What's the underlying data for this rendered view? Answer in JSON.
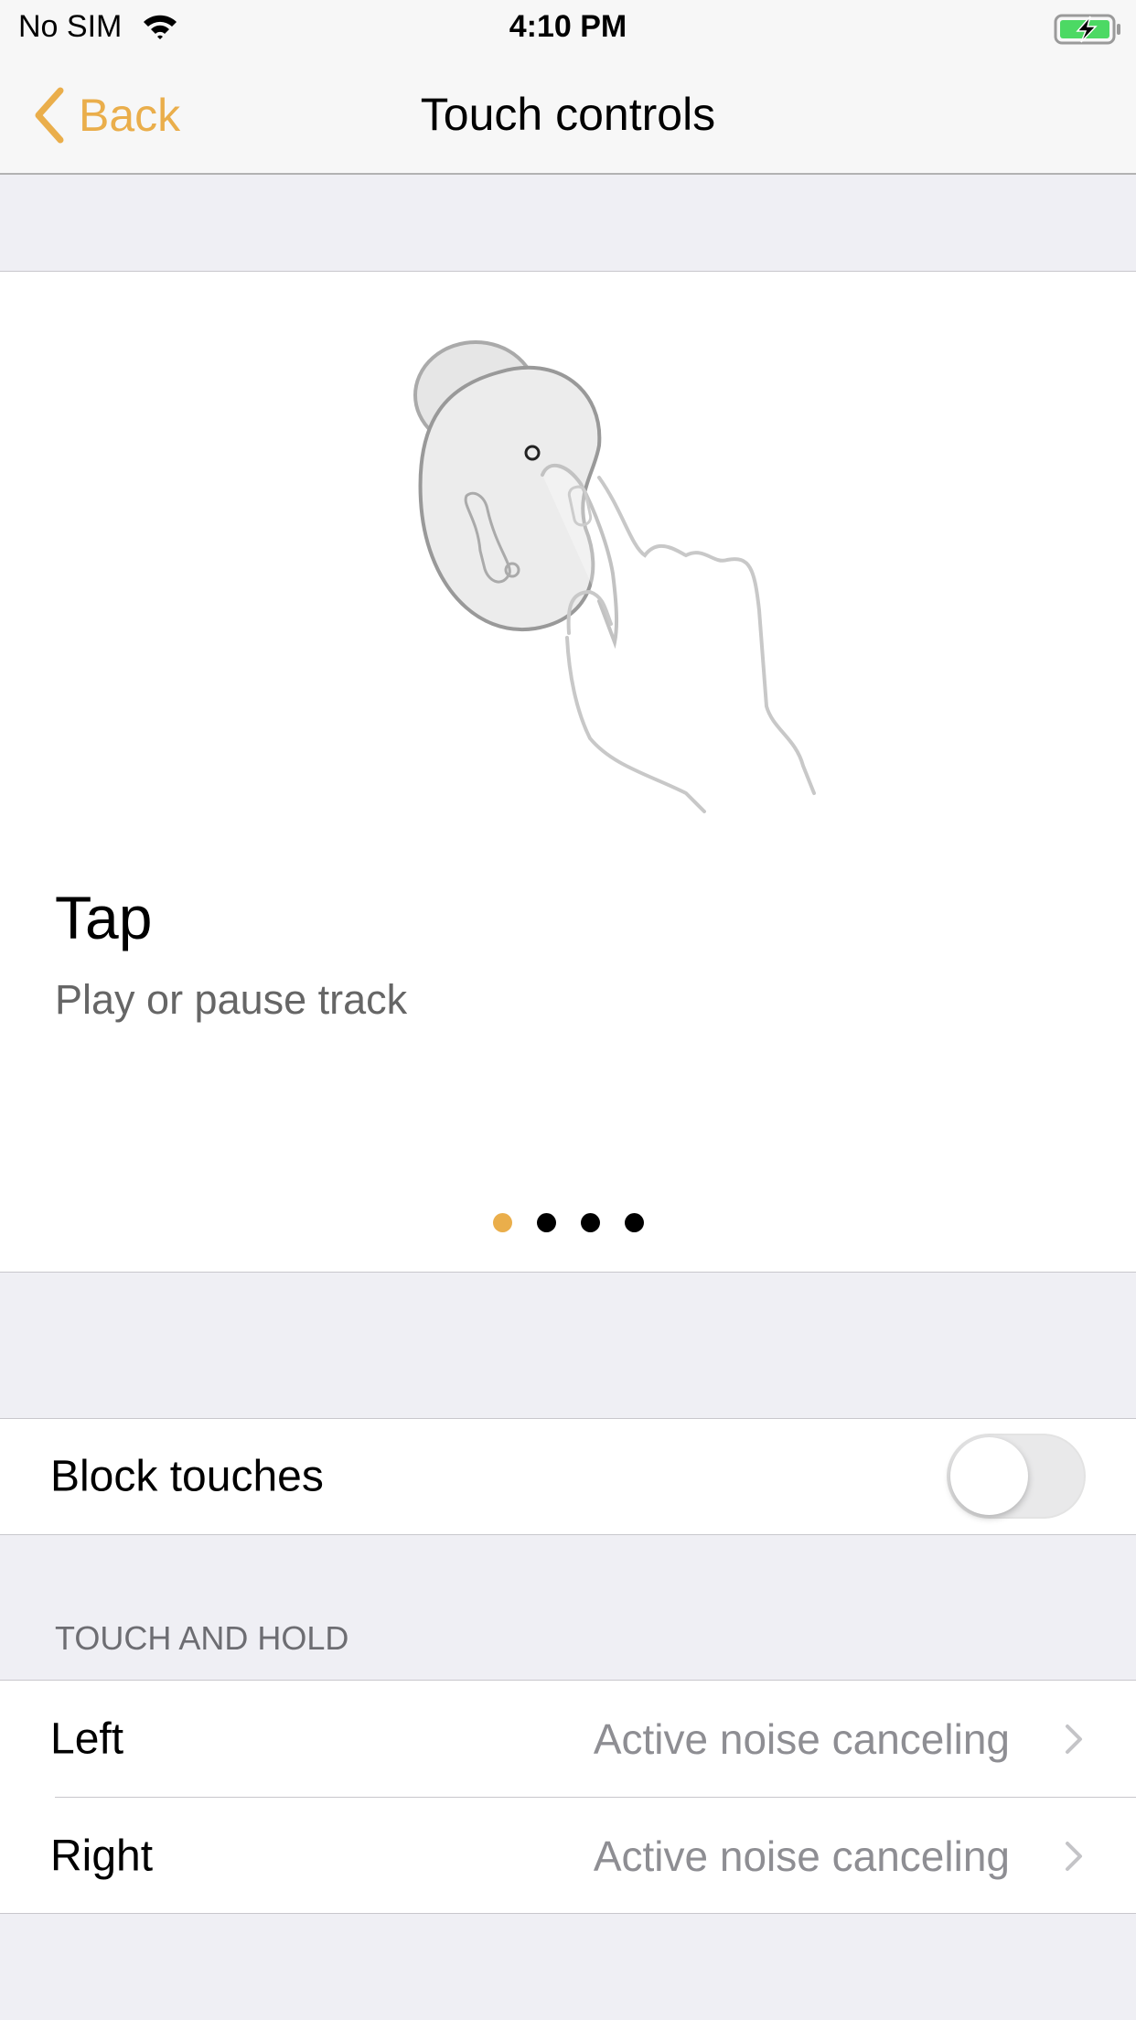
{
  "status_bar": {
    "carrier": "No SIM",
    "time": "4:10 PM",
    "wifi_icon": "wifi-icon",
    "battery_icon": "battery-charging-icon",
    "battery_color": "#4cd964"
  },
  "nav": {
    "back_label": "Back",
    "title": "Touch controls",
    "accent_color": "#eaae4b"
  },
  "carousel": {
    "title": "Tap",
    "description": "Play or pause track",
    "page_count": 4,
    "current_page": 1,
    "active_dot_color": "#eaae4b"
  },
  "block_touches": {
    "label": "Block touches",
    "enabled": false
  },
  "touch_and_hold": {
    "header": "TOUCH AND HOLD",
    "rows": [
      {
        "label": "Left",
        "value": "Active noise canceling"
      },
      {
        "label": "Right",
        "value": "Active noise canceling"
      }
    ]
  }
}
